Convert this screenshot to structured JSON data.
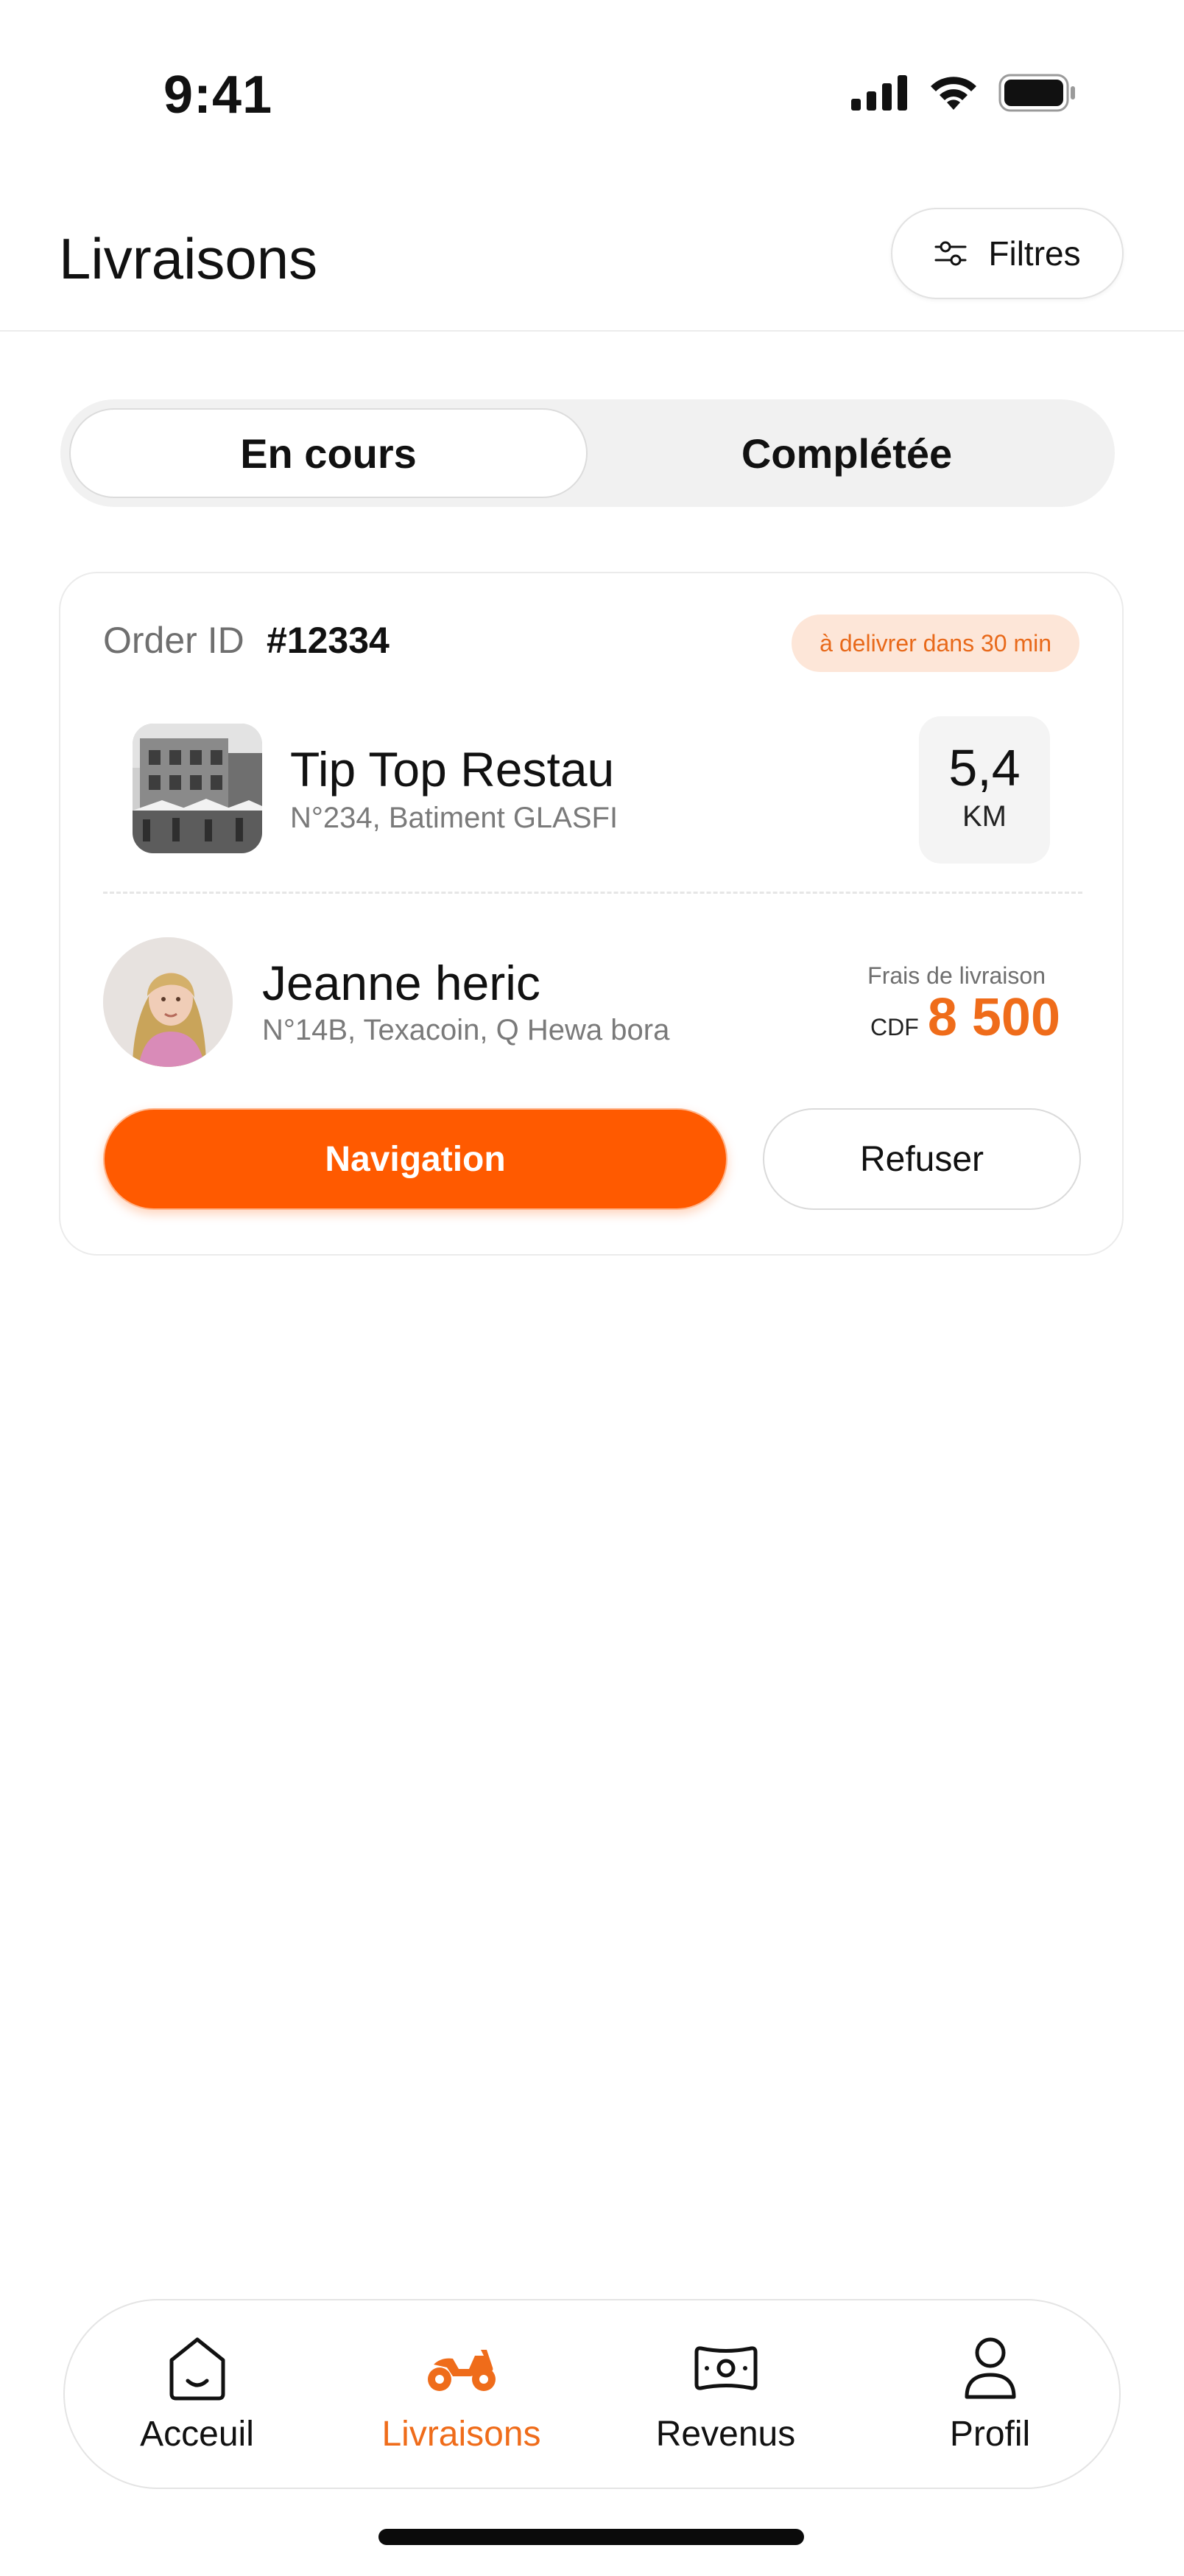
{
  "status_bar": {
    "time": "9:41"
  },
  "header": {
    "title": "Livraisons",
    "filter_label": "Filtres"
  },
  "tabs": [
    {
      "label": "En cours",
      "active": true
    },
    {
      "label": "Complétée",
      "active": false
    }
  ],
  "order": {
    "id_label": "Order ID",
    "id_value": "#12334",
    "eta_badge": "à delivrer dans 30 min",
    "restaurant": {
      "name": "Tip Top Restau",
      "address": "N°234, Batiment GLASFI"
    },
    "distance": {
      "value": "5,4",
      "unit": "KM"
    },
    "customer": {
      "name": "Jeanne heric",
      "address": "N°14B, Texacoin, Q Hewa bora"
    },
    "fee": {
      "label": "Frais de livraison",
      "currency": "CDF",
      "amount": "8 500"
    },
    "actions": {
      "navigate_label": "Navigation",
      "refuse_label": "Refuser"
    }
  },
  "bottom_nav": [
    {
      "label": "Acceuil",
      "icon": "home-icon",
      "active": false
    },
    {
      "label": "Livraisons",
      "icon": "motorbike-icon",
      "active": true
    },
    {
      "label": "Revenus",
      "icon": "cash-icon",
      "active": false
    },
    {
      "label": "Profil",
      "icon": "user-icon",
      "active": false
    }
  ],
  "colors": {
    "accent": "#FF5A00",
    "accent_text": "#EF6C1A",
    "badge_bg": "#FDE6D8"
  }
}
